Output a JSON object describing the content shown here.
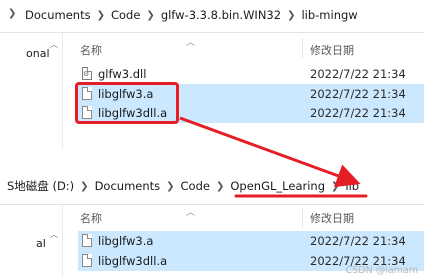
{
  "top": {
    "breadcrumb": [
      "Documents",
      "Code",
      "glfw-3.3.8.bin.WIN32",
      "lib-mingw"
    ],
    "side_label": "onal",
    "header": {
      "name": "名称",
      "modified": "修改日期"
    },
    "files": [
      {
        "name": "glfw3.dll",
        "date": "2022/7/22 21:34",
        "icon": "dll-settings-icon",
        "selected": false
      },
      {
        "name": "libglfw3.a",
        "date": "2022/7/22 21:34",
        "icon": "file-icon",
        "selected": true
      },
      {
        "name": "libglfw3dll.a",
        "date": "2022/7/22 21:34",
        "icon": "file-icon",
        "selected": true
      }
    ]
  },
  "bottom": {
    "breadcrumb": [
      "S地磁盘 (D:)",
      "Documents",
      "Code",
      "OpenGL_Learing",
      "lib"
    ],
    "side_label": "al",
    "header": {
      "name": "名称",
      "modified": "修改日期"
    },
    "files": [
      {
        "name": "libglfw3.a",
        "date": "2022/7/22 21:34",
        "icon": "file-icon",
        "selected": true
      },
      {
        "name": "libglfw3dll.a",
        "date": "2022/7/22 21:34",
        "icon": "file-icon",
        "selected": true
      }
    ]
  },
  "watermark": "CSDN @iamam",
  "colors": {
    "selection": "#cce8ff",
    "annotation": "#e51e26"
  }
}
